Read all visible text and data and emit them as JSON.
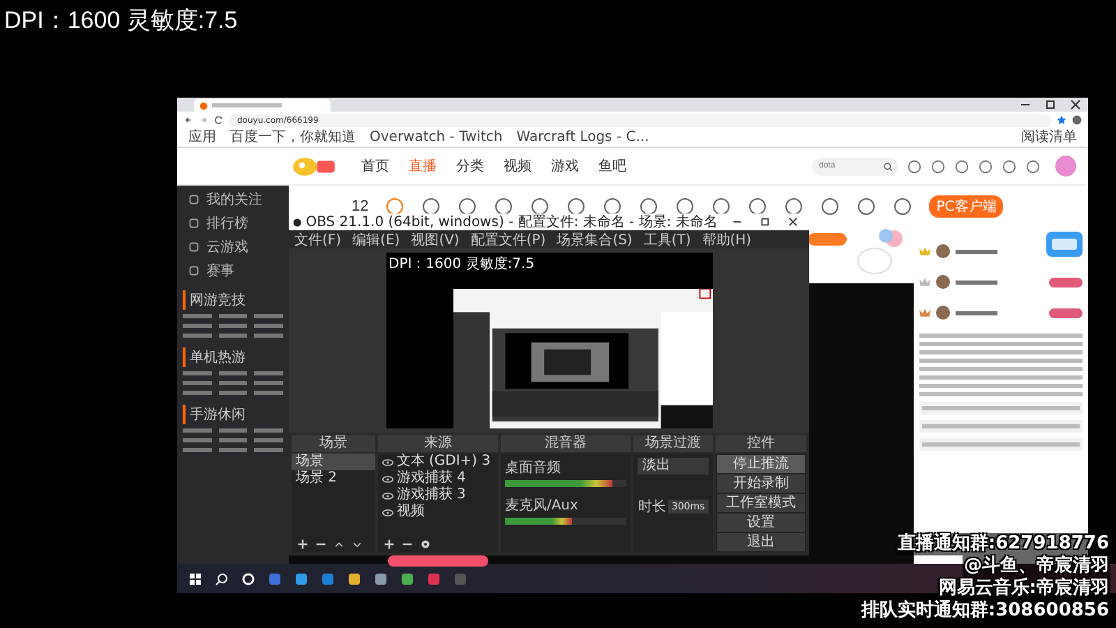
{
  "overlay_caption": "DPI：1600 灵敏度:7.5",
  "browser": {
    "url": "douyu.com/666199",
    "bookmarks": [
      "应用",
      "百度一下，你就知道",
      "Overwatch - Twitch",
      "Warcraft Logs - C..."
    ],
    "reading_list": "阅读清单"
  },
  "site": {
    "nav": [
      {
        "label": "首页",
        "selected": false
      },
      {
        "label": "直播",
        "selected": true
      },
      {
        "label": "分类",
        "selected": false
      },
      {
        "label": "视频",
        "selected": false
      },
      {
        "label": "游戏",
        "selected": false
      },
      {
        "label": "鱼吧",
        "selected": false
      }
    ],
    "search": {
      "placeholder": "dota"
    },
    "sidebar": [
      "我的关注",
      "排行榜",
      "云游戏",
      "赛事"
    ],
    "sections": [
      "网游竞技",
      "单机热游",
      "手游休闲"
    ],
    "date": "12",
    "client_button": "PC客户端"
  },
  "obs": {
    "title": "OBS 21.1.0 (64bit, windows) - 配置文件: 未命名 - 场景: 未命名",
    "menu": [
      "文件(F)",
      "编辑(E)",
      "视图(V)",
      "配置文件(P)",
      "场景集合(S)",
      "工具(T)",
      "帮助(H)"
    ],
    "preview_caption": "DPI：1600 灵敏度:7.5",
    "docks": [
      "场景",
      "来源",
      "混音器",
      "场景过渡",
      "控件"
    ],
    "scenes": [
      {
        "label": "场景",
        "selected": true
      },
      {
        "label": "场景 2",
        "selected": false
      }
    ],
    "sources": [
      "文本 (GDI+) 3",
      "游戏捕获 4",
      "游戏捕获 3",
      "视频"
    ],
    "mixer": [
      {
        "name": "桌面音频",
        "level": 0.88
      },
      {
        "name": "麦克风/Aux",
        "level": 0.55
      }
    ],
    "transition": {
      "value": "淡出",
      "duration_label": "时长",
      "duration": "300ms"
    },
    "controls": [
      {
        "label": "停止推流",
        "active": true
      },
      {
        "label": "开始录制",
        "active": false
      },
      {
        "label": "工作室模式",
        "active": false
      },
      {
        "label": "设置",
        "active": false
      },
      {
        "label": "退出",
        "active": false
      }
    ]
  },
  "captions": [
    "直播通知群:627918776",
    "@斗鱼、帝宸清羽",
    "网易云音乐:帝宸清羽",
    "排队实时通知群:308600856"
  ]
}
